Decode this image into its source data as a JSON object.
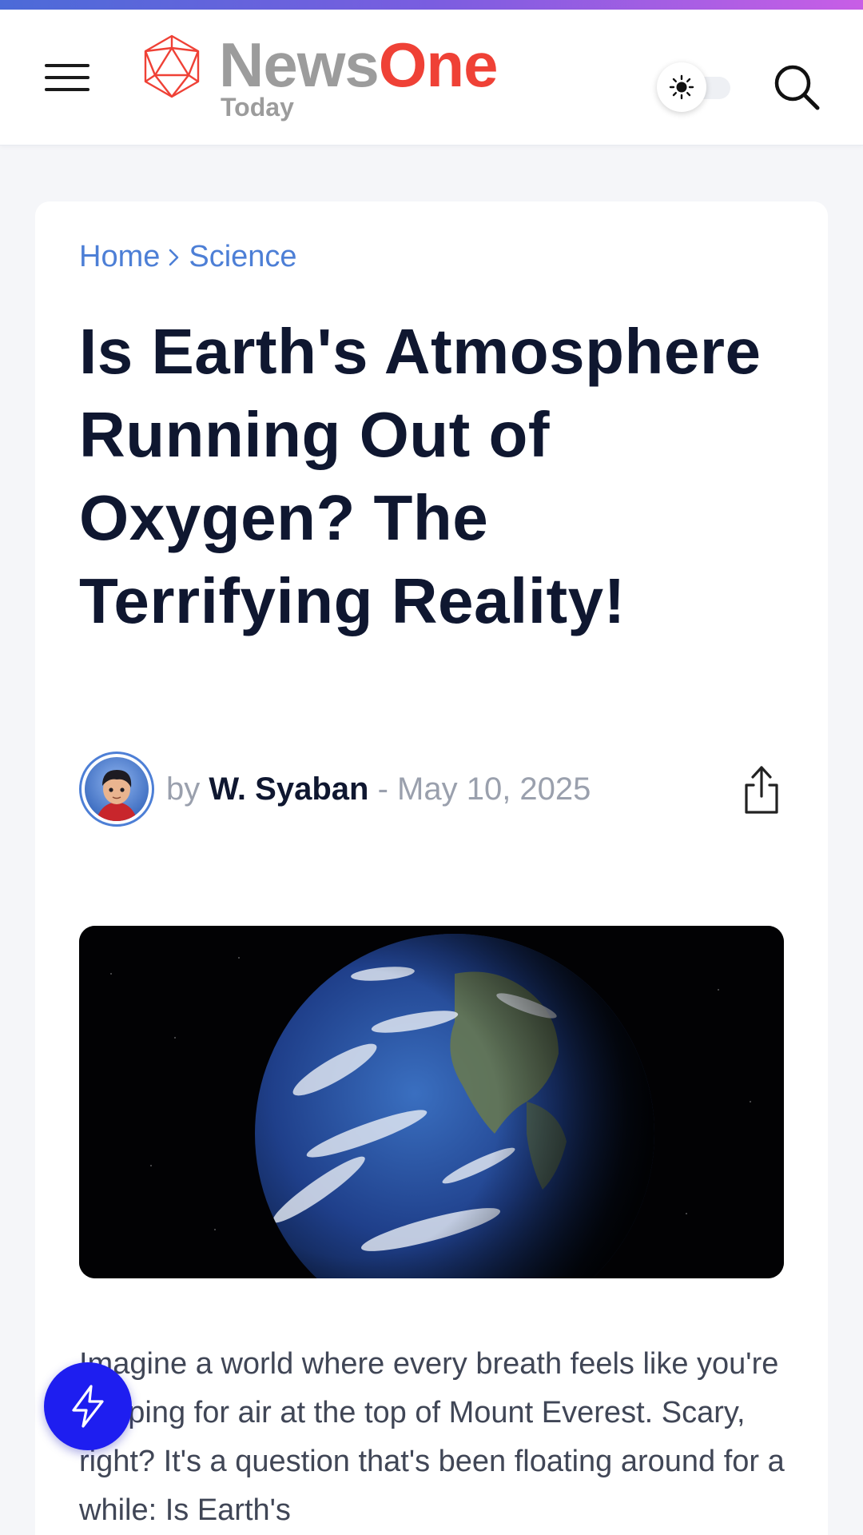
{
  "header": {
    "logo_primary": "News",
    "logo_accent": "One",
    "logo_subtitle": "Today"
  },
  "breadcrumb": {
    "home": "Home",
    "separator": "›",
    "category": "Science"
  },
  "article": {
    "title": "Is Earth's Atmosphere Running Out of Oxygen? The Terrifying Reality!",
    "by_label": "by",
    "author": "W. Syaban",
    "date_separator": "-",
    "date": "May 10, 2025",
    "body_excerpt": "Imagine a world where every breath feels like you're gasping for air at the top of Mount Everest. Scary, right? It's a question that's been floating around for a while: Is Earth's"
  },
  "icons": {
    "menu": "hamburger-menu-icon",
    "logo": "icosahedron-logo-icon",
    "theme": "sun-icon",
    "search": "search-icon",
    "share": "share-icon",
    "fab": "lightning-bolt-icon"
  },
  "colors": {
    "accent_blue": "#4d7fd6",
    "logo_red": "#ef4136",
    "logo_gray": "#9c9c9c",
    "title": "#0f1730",
    "fab": "#1e1ef0"
  }
}
